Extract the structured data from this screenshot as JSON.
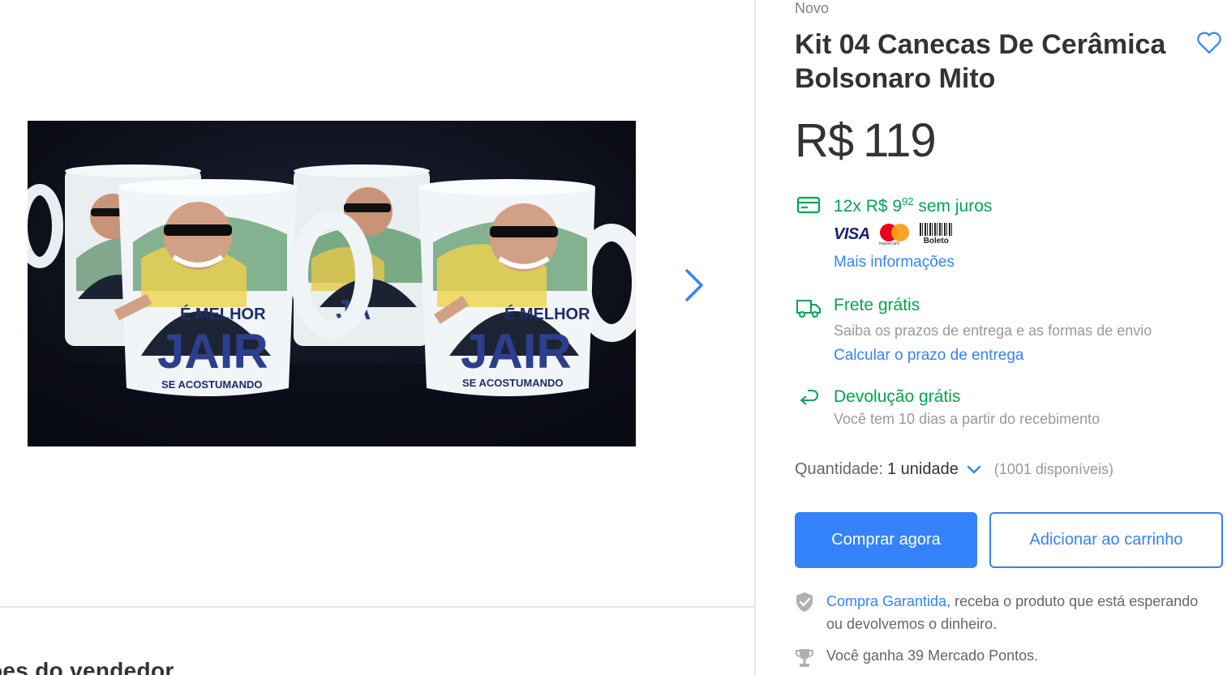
{
  "product": {
    "condition": "Novo",
    "title": "Kit 04 Canecas De Cerâmica Bolsonaro Mito",
    "currency": "R$",
    "price": "119",
    "image_mug_texts": {
      "line1": "É MELHOR",
      "line2": "JAIR",
      "line3": "SE ACOSTUMANDO"
    }
  },
  "payment": {
    "installments_prefix": "12x R$ 9",
    "installments_cents": "92",
    "installments_suffix": "sem juros",
    "brands": [
      "visa-logo",
      "mastercard-logo",
      "boleto-logo"
    ],
    "visa_text": "VISA",
    "mastercard_text": "mastercard",
    "boleto_text": "Boleto",
    "more_info_link": "Mais informações"
  },
  "shipping": {
    "title": "Frete grátis",
    "subtitle": "Saiba os prazos de entrega e as formas de envio",
    "link": "Calcular o prazo de entrega"
  },
  "returns": {
    "title": "Devolução grátis",
    "subtitle": "Você tem 10 dias a partir do recebimento"
  },
  "quantity": {
    "label": "Quantidade:",
    "value": "1 unidade",
    "available": "(1001 disponíveis)"
  },
  "actions": {
    "buy_now": "Comprar agora",
    "add_to_cart": "Adicionar ao carrinho"
  },
  "guarantee": {
    "link": "Compra Garantida",
    "text": ", receba o produto que está esperando ou devolvemos o dinheiro."
  },
  "points": {
    "text": "Você ganha 39 Mercado Pontos."
  },
  "seller_section": {
    "heading": "ões do vendedor"
  },
  "colors": {
    "accent_blue": "#3483fa",
    "success_green": "#00a650",
    "text_primary": "#333333",
    "text_muted": "#999999",
    "divider": "#e6e6e6"
  },
  "icons": {
    "favorite": "heart-icon",
    "next": "chevron-right-icon",
    "card": "credit-card-icon",
    "shipping": "truck-icon",
    "returns": "return-arrow-icon",
    "quantity_dropdown": "chevron-down-icon",
    "guarantee": "shield-check-icon",
    "points": "trophy-icon"
  }
}
